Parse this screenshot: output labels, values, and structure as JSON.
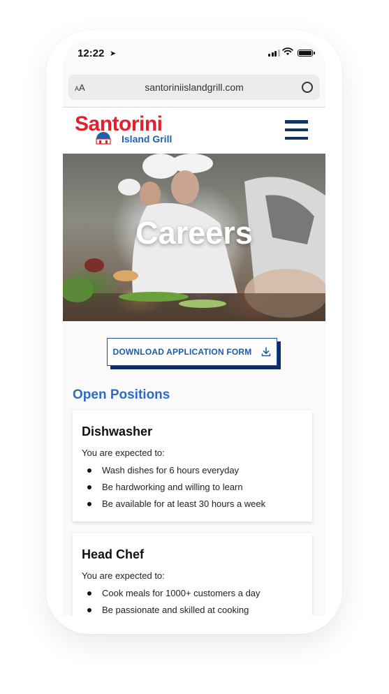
{
  "status_bar": {
    "time": "12:22",
    "location_icon": "location-arrow-icon",
    "signal_icon": "cellular-signal-icon",
    "wifi_icon": "wifi-icon",
    "battery_icon": "battery-icon"
  },
  "browser": {
    "text_size_label_small": "A",
    "text_size_label_large": "A",
    "url": "santoriniislandgrill.com",
    "reload_icon": "reload-icon"
  },
  "site_header": {
    "logo_main": "Santorini",
    "logo_sub": "Island Grill",
    "menu_icon": "hamburger-menu-icon"
  },
  "hero": {
    "title": "Careers"
  },
  "download_button": {
    "label": "DOWNLOAD APPLICATION FORM",
    "icon": "download-icon"
  },
  "open_positions": {
    "heading": "Open Positions",
    "jobs": [
      {
        "title": "Dishwasher",
        "intro": "You are expected to:",
        "requirements": [
          "Wash dishes for 6 hours everyday",
          "Be hardworking and willing to learn",
          "Be available for at least 30 hours a week"
        ]
      },
      {
        "title": "Head Chef",
        "intro": "You are expected to:",
        "requirements": [
          "Cook meals for 1000+ customers a day",
          "Be passionate and skilled at cooking"
        ]
      }
    ]
  },
  "colors": {
    "brand_red": "#e3202b",
    "brand_blue": "#1d62b4",
    "navy": "#16335f",
    "accent_blue": "#2b6cc7"
  }
}
